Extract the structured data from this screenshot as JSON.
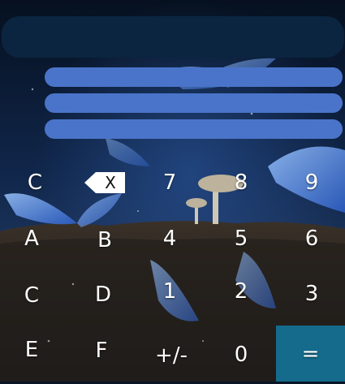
{
  "display": {
    "value": ""
  },
  "memory": [
    "",
    "",
    ""
  ],
  "keys": {
    "row1": {
      "c1": "C",
      "backspace_label": "X",
      "seven": "7",
      "eight": "8",
      "nine": "9"
    },
    "row2": {
      "a": "A",
      "b": "B",
      "four": "4",
      "five": "5",
      "six": "6"
    },
    "row3": {
      "c2": "C",
      "d": "D",
      "one": "1",
      "two": "2",
      "three": "3"
    },
    "row4": {
      "e": "E",
      "f": "F",
      "sign": "+/-",
      "zero": "0",
      "equals": "="
    }
  },
  "icons": {
    "backspace": "backspace-icon",
    "background": "night-forest-butterflies-mushrooms"
  },
  "colors": {
    "display_bg": "#0b2540",
    "memory_bar": "#4a74c9",
    "equals_key": "#146b8c",
    "key_text": "#ffffff"
  }
}
